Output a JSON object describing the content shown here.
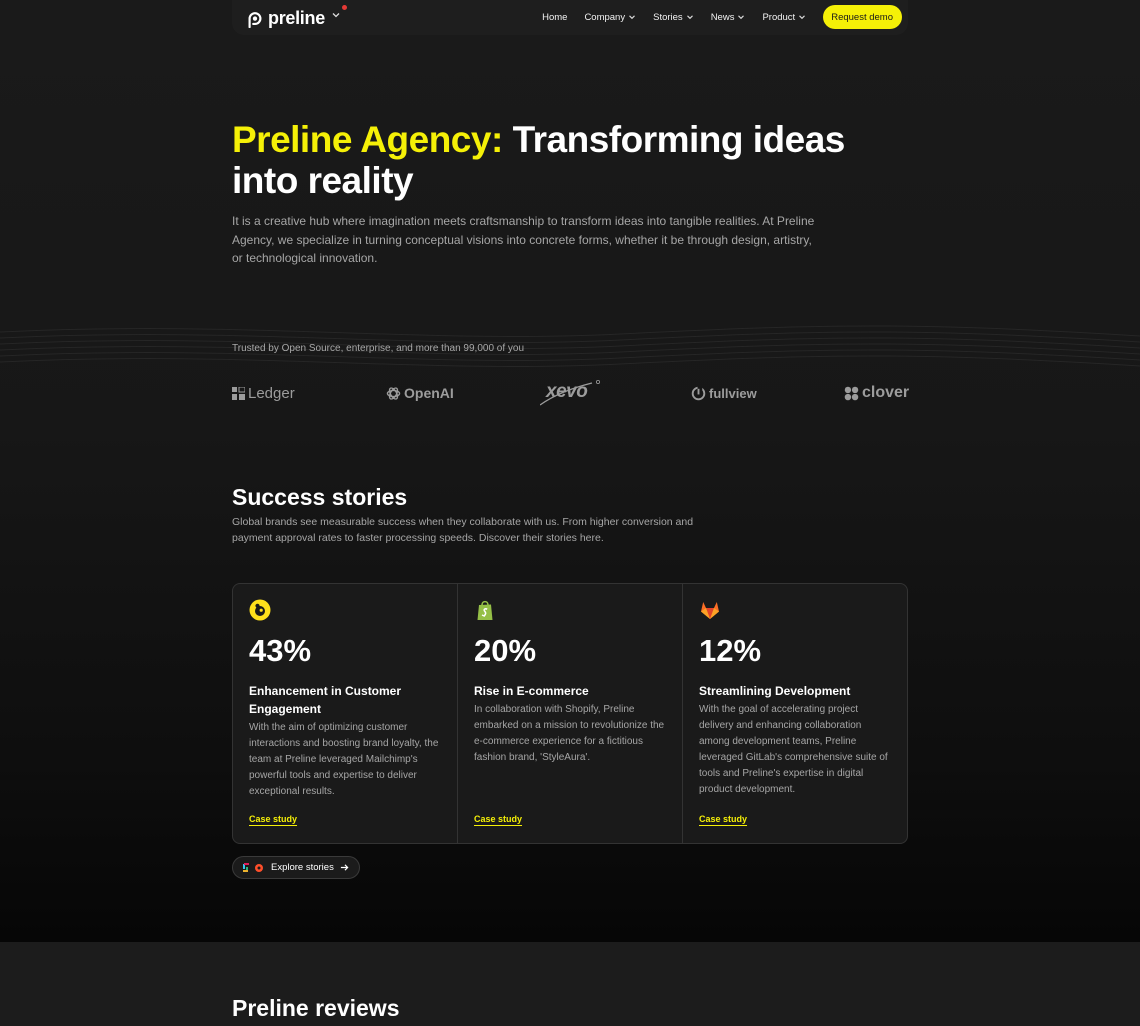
{
  "header": {
    "brand": "preline",
    "nav": [
      {
        "label": "Home",
        "has_dropdown": false
      },
      {
        "label": "Company",
        "has_dropdown": true
      },
      {
        "label": "Stories",
        "has_dropdown": true
      },
      {
        "label": "News",
        "has_dropdown": true
      },
      {
        "label": "Product",
        "has_dropdown": true
      }
    ],
    "cta_label": "Request demo"
  },
  "hero": {
    "title_accent": "Preline Agency:",
    "title_rest": "Transforming ideas into reality",
    "description": "It is a creative hub where imagination meets craftsmanship to transform ideas into tangible realities. At Preline Agency, we specialize in turning conceptual visions into concrete forms, whether it be through design, artistry, or technological innovation."
  },
  "trusted": {
    "text": "Trusted by Open Source, enterprise, and more than 99,000 of you",
    "brands": [
      "Ledger",
      "OpenAI",
      "xevo",
      "fullview",
      "clover"
    ]
  },
  "success": {
    "title": "Success stories",
    "description": "Global brands see measurable success when they collaborate with us. From higher conversion and payment approval rates to faster processing speeds. Discover their stories here.",
    "cards": [
      {
        "icon": "mailchimp-icon",
        "stat": "43%",
        "title": "Enhancement in Customer Engagement",
        "text": "With the aim of optimizing customer interactions and boosting brand loyalty, the team at Preline leveraged Mailchimp's powerful tools and expertise to deliver exceptional results.",
        "link": "Case study"
      },
      {
        "icon": "shopify-icon",
        "stat": "20%",
        "title": "Rise in E-commerce",
        "text": "In collaboration with Shopify, Preline embarked on a mission to revolutionize the e-commerce experience for a fictitious fashion brand, 'StyleAura'.",
        "link": "Case study"
      },
      {
        "icon": "gitlab-icon",
        "stat": "12%",
        "title": "Streamlining Development",
        "text": "With the goal of accelerating project delivery and enhancing collaboration among development teams, Preline leveraged GitLab's comprehensive suite of tools and Preline's expertise in digital product development.",
        "link": "Case study"
      }
    ],
    "explore_label": "Explore stories"
  },
  "reviews": {
    "title": "Preline reviews"
  },
  "colors": {
    "accent": "#f5f007",
    "background": "#121212",
    "notify": "#e53935"
  }
}
